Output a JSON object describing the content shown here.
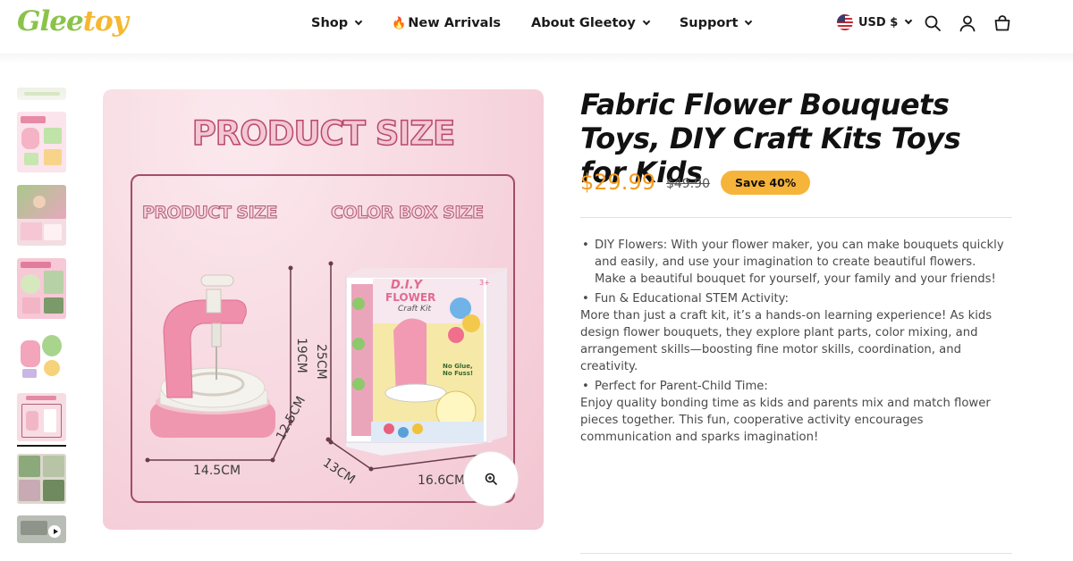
{
  "header": {
    "logo": {
      "part1": "Glee",
      "part2": "toy"
    },
    "nav": [
      {
        "label": "Shop",
        "has_dropdown": true
      },
      {
        "label": "New Arrivals",
        "icon": "fire-icon",
        "has_dropdown": false
      },
      {
        "label": "About Gleetoy",
        "has_dropdown": true
      },
      {
        "label": "Support",
        "has_dropdown": true
      }
    ],
    "currency": {
      "label": "USD $",
      "flag": "us-flag-icon"
    },
    "icons": [
      "search-icon",
      "account-icon",
      "cart-icon"
    ]
  },
  "gallery": {
    "thumbnail_count": 8,
    "active_thumbnail": 6,
    "main_image": {
      "title": "PRODUCT SIZE",
      "label_left": "PRODUCT SIZE",
      "label_right": "COLOR BOX SIZE",
      "box_text": {
        "line1": "D.I.Y",
        "line2": "FLOWER",
        "line3": "Craft Kit",
        "badge": "No Glue, No Fuss!",
        "age": "3+"
      },
      "dims": {
        "product_width": "14.5CM",
        "product_height": "19CM",
        "product_depth": "12.5CM",
        "box_height": "25CM",
        "box_depth": "13CM",
        "box_width": "16.6CM"
      }
    },
    "zoom_icon": "zoom-in-icon"
  },
  "product": {
    "title": "Fabric Flower Bouquets Toys, DIY Craft Kits Toys for Kids",
    "price": "$29.99",
    "compare_price": "$49.90",
    "save_badge": "Save 40%",
    "description": [
      {
        "heading": "DIY Flowers: With your flower maker, you can make bouquets quickly and easily, and use your imagination to create beautiful flowers. Make a beautiful bouquet for yourself, your family and your friends!",
        "body": ""
      },
      {
        "heading": "Fun & Educational STEM Activity:",
        "body": "More than just a craft kit, it’s a hands-on learning experience! As kids design flower bouquets, they explore plant parts, color mixing, and arrangement skills—boosting fine motor skills, coordination, and creativity."
      },
      {
        "heading": "Perfect for Parent-Child Time:",
        "body": "Enjoy quality bonding time as kids and parents mix and match flower pieces together. This fun, cooperative activity encourages communication and sparks imagination!"
      }
    ]
  },
  "colors": {
    "price": "#f29b1d",
    "badge": "#f7b43a",
    "logo_green": "#8bc34a",
    "logo_yellow": "#f5b82e"
  }
}
